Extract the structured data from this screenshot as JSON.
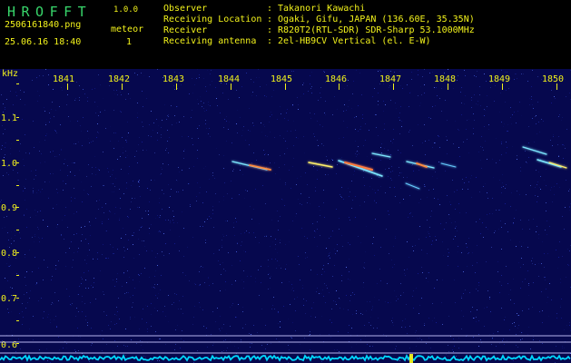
{
  "header": {
    "app_title": "HROFFT",
    "app_version": "1.0.0",
    "file_name": "2506161840.png",
    "timestamp": "25.06.16 18:40",
    "meteor_label": "meteor",
    "meteor_count": "1",
    "meta": [
      {
        "label": "Observer",
        "sep": ":",
        "value": "Takanori Kawachi"
      },
      {
        "label": "Receiving Location",
        "sep": ":",
        "value": "Ogaki, Gifu, JAPAN (136.60E, 35.35N)"
      },
      {
        "label": "Receiver",
        "sep": ":",
        "value": "R820T2(RTL-SDR) SDR-Sharp 53.1000MHz"
      },
      {
        "label": "Receiving antenna",
        "sep": ":",
        "value": "2el-HB9CV Vertical (el. E-W)"
      }
    ]
  },
  "spectrogram": {
    "unit_label": "kHz",
    "x_ticks": [
      "1841",
      "1842",
      "1843",
      "1844",
      "1845",
      "1846",
      "1847",
      "1848",
      "1849",
      "1850"
    ],
    "y_ticks": [
      "1.1",
      "1.0",
      "0.9",
      "0.8",
      "0.7",
      "0.6"
    ],
    "colors": {
      "background": "#06084e",
      "trace": "#7de8ff",
      "noise": "#1d2aa0",
      "axis_text": "#f2f21b",
      "reference_lines": "#c8c8ff"
    }
  }
}
